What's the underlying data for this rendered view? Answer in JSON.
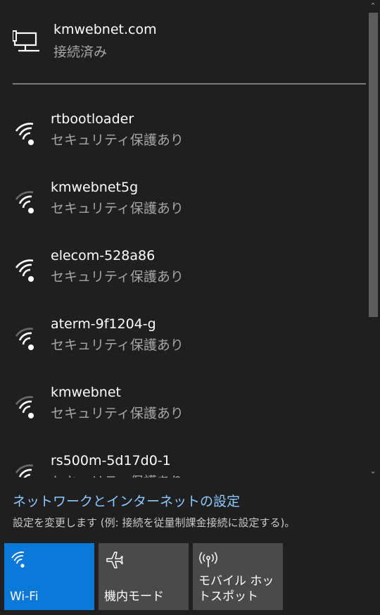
{
  "connected_network": {
    "name": "kmwebnet.com",
    "status": "接続済み",
    "icon": "ethernet-icon"
  },
  "networks": [
    {
      "name": "rtbootloader",
      "status": "セキュリティ保護あり",
      "icon": "wifi-icon"
    },
    {
      "name": "kmwebnet5g",
      "status": "セキュリティ保護あり",
      "icon": "wifi-icon"
    },
    {
      "name": "elecom-528a86",
      "status": "セキュリティ保護あり",
      "icon": "wifi-icon"
    },
    {
      "name": "aterm-9f1204-g",
      "status": "セキュリティ保護あり",
      "icon": "wifi-icon"
    },
    {
      "name": "kmwebnet",
      "status": "セキュリティ保護あり",
      "icon": "wifi-icon"
    },
    {
      "name": "rs500m-5d17d0-1",
      "status": "セキュリティ保護あり",
      "icon": "wifi-icon"
    }
  ],
  "settings": {
    "link_label": "ネットワークとインターネットの設定",
    "description": "設定を変更します (例: 接続を従量制課金接続に設定する)。"
  },
  "quick_actions": [
    {
      "label": "Wi-Fi",
      "icon": "wifi-icon",
      "active": true
    },
    {
      "label": "機内モード",
      "icon": "airplane-icon",
      "active": false
    },
    {
      "label": "モバイル ホットスポット",
      "icon": "hotspot-icon",
      "active": false
    }
  ],
  "colors": {
    "background": "#1f1f1f",
    "accent": "#0a78d7",
    "link": "#8fc8ff",
    "tile": "#4a4a4a"
  }
}
